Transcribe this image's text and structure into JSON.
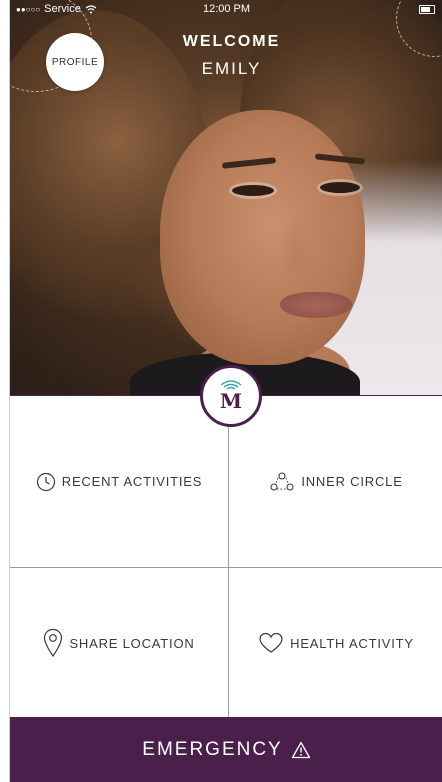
{
  "status_bar": {
    "carrier": "Service",
    "time": "12:00 PM"
  },
  "header": {
    "welcome": "WELCOME",
    "name": "EMILY",
    "profile_label": "PROFILE"
  },
  "logo": {
    "letter": "M"
  },
  "menu": {
    "recent_activities": "RECENT ACTIVITIES",
    "inner_circle": "INNER CIRCLE",
    "share_location": "SHARE LOCATION",
    "health_activity": "HEALTH ACTIVITY"
  },
  "emergency": {
    "label": "EMERGENCY"
  },
  "colors": {
    "brand_purple": "#4b1f4c",
    "text_gray": "#3a3a3a",
    "divider": "#9c9c9c",
    "logo_wifi": "#3fa7a0"
  }
}
